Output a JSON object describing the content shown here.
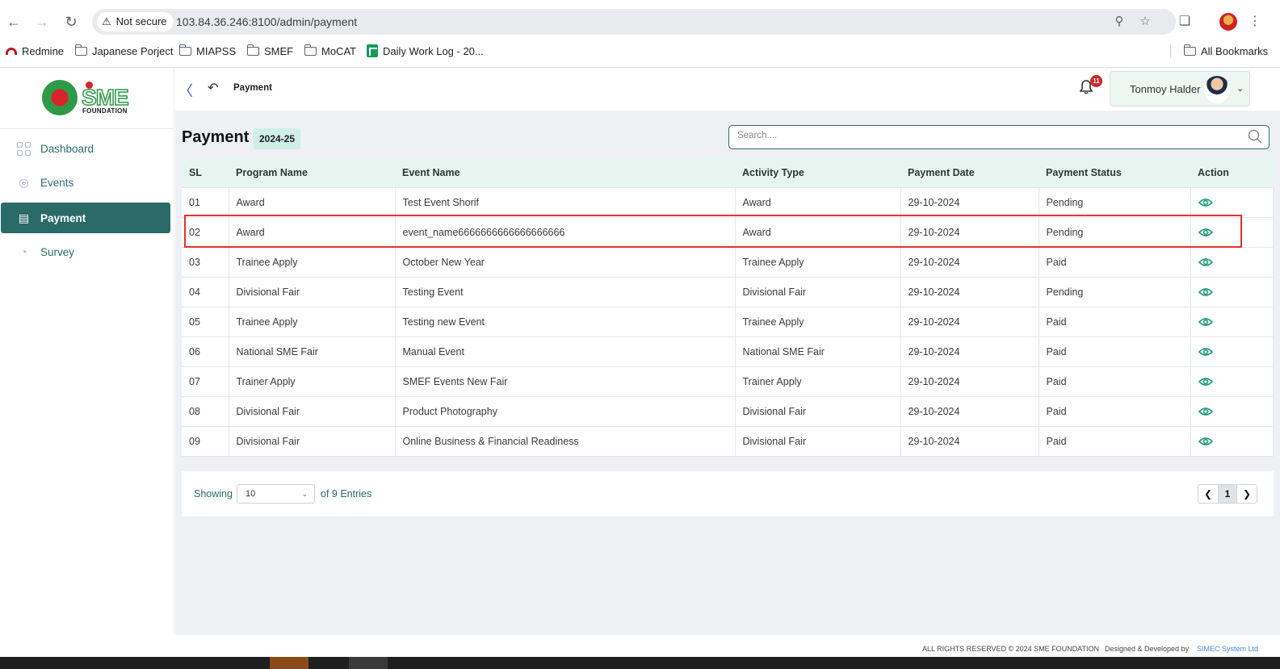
{
  "browser": {
    "security_label": "Not secure",
    "url": "103.84.36.246:8100/admin/payment",
    "bookmarks": [
      {
        "label": "Redmine"
      },
      {
        "label": "Japanese Porject"
      },
      {
        "label": "MIAPSS"
      },
      {
        "label": "SMEF"
      },
      {
        "label": "MoCAT"
      },
      {
        "label": "Daily Work Log - 20..."
      }
    ],
    "all_bookmarks_label": "All Bookmarks"
  },
  "brand": {
    "logo_text": "SME",
    "sub_text": "FOUNDATION"
  },
  "sidebar": {
    "items": [
      {
        "label": "Dashboard",
        "icon": "grid-icon",
        "active": false
      },
      {
        "label": "Events",
        "icon": "events-icon",
        "active": false
      },
      {
        "label": "Payment",
        "icon": "payment-icon",
        "active": true
      },
      {
        "label": "Survey",
        "icon": "pie-chart-icon",
        "active": false
      }
    ]
  },
  "header": {
    "breadcrumb": "Payment",
    "notification_count": "11",
    "user_name": "Tonmoy Halder"
  },
  "page": {
    "title": "Payment",
    "fiscal_year": "2024-25",
    "search_placeholder": "Search....",
    "columns": [
      "SL",
      "Program Name",
      "Event Name",
      "Activity Type",
      "Payment Date",
      "Payment Status",
      "Action"
    ],
    "rows": [
      {
        "sl": "01",
        "program": "Award",
        "event": "Test Event Shorif",
        "activity": "Award",
        "date": "29-10-2024",
        "status": "Pending"
      },
      {
        "sl": "02",
        "program": "Award",
        "event": "event_name6666666666666666666",
        "activity": "Award",
        "date": "29-10-2024",
        "status": "Pending"
      },
      {
        "sl": "03",
        "program": "Trainee Apply",
        "event": "October New Year",
        "activity": "Trainee Apply",
        "date": "29-10-2024",
        "status": "Paid"
      },
      {
        "sl": "04",
        "program": "Divisional Fair",
        "event": "Testing Event",
        "activity": "Divisional Fair",
        "date": "29-10-2024",
        "status": "Pending"
      },
      {
        "sl": "05",
        "program": "Trainee Apply",
        "event": "Testing new Event",
        "activity": "Trainee Apply",
        "date": "29-10-2024",
        "status": "Paid"
      },
      {
        "sl": "06",
        "program": "National SME Fair",
        "event": "Manual Event",
        "activity": "National SME Fair",
        "date": "29-10-2024",
        "status": "Paid"
      },
      {
        "sl": "07",
        "program": "Trainer Apply",
        "event": "SMEF Events New Fair",
        "activity": "Trainer Apply",
        "date": "29-10-2024",
        "status": "Paid"
      },
      {
        "sl": "08",
        "program": "Divisional Fair",
        "event": "Product Photography",
        "activity": "Divisional Fair",
        "date": "29-10-2024",
        "status": "Paid"
      },
      {
        "sl": "09",
        "program": "Divisional Fair",
        "event": "Online Business & Financial Readiness",
        "activity": "Divisional Fair",
        "date": "29-10-2024",
        "status": "Paid"
      }
    ]
  },
  "pagination": {
    "showing_label": "Showing",
    "page_size": "10",
    "entries_label": "of 9 Entries",
    "current_page": "1"
  },
  "footer": {
    "rights": "ALL RIGHTS RESERVED © 2024 SME FOUNDATION",
    "designed_by": "Designed & Developed by",
    "company": "SIMEC System Ltd"
  },
  "colors": {
    "accent": "#2a6b67",
    "header_row": "#e6f5ef",
    "eye_icon": "#1f9d7a",
    "highlight": "#e53030"
  }
}
